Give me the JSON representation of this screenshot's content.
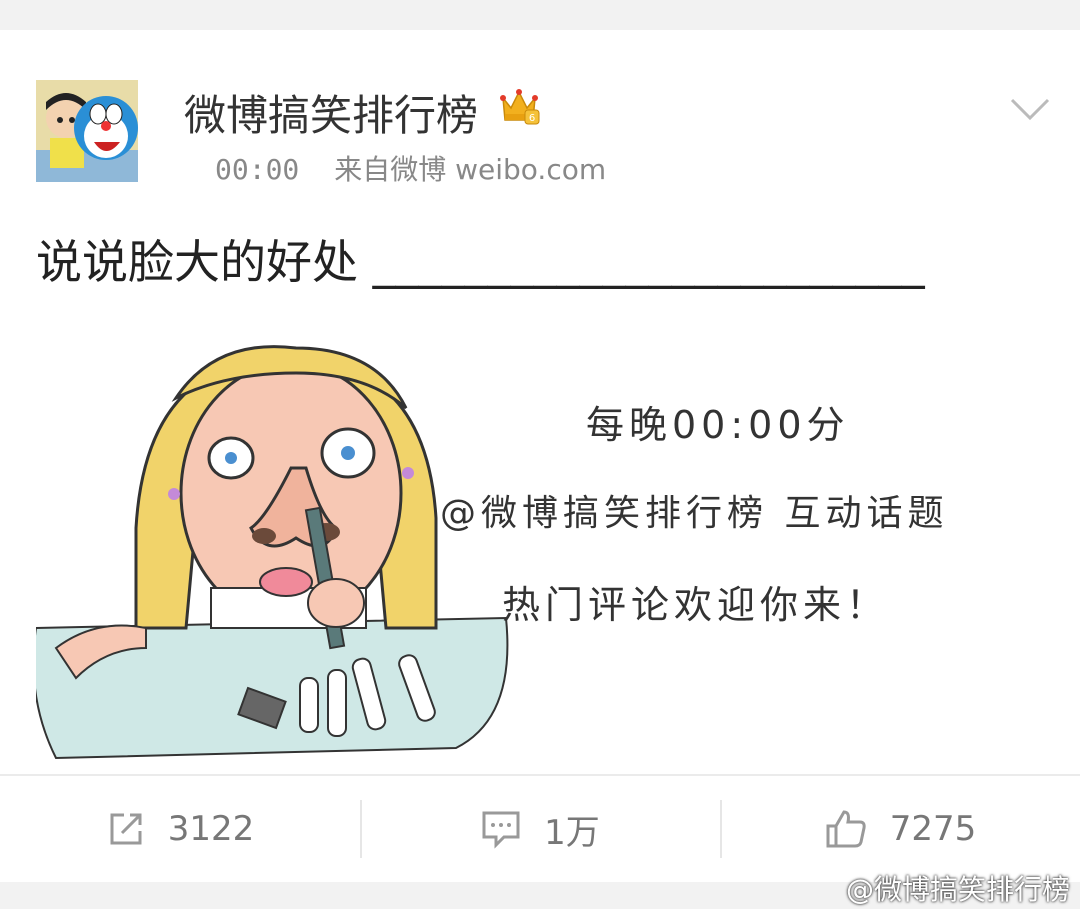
{
  "post": {
    "user_name": "微博搞笑排行榜",
    "time": "00:00",
    "source": "来自微博 weibo.com",
    "text": "说说脸大的好处 ________________________",
    "vip_icon": "crown-badge-icon",
    "menu_icon": "chevron-down-icon"
  },
  "image": {
    "line1": "每晚00:00分",
    "line2": "@微博搞笑排行榜  互动话题",
    "line3": "热门评论欢迎你来！"
  },
  "actions": {
    "repost_count": "3122",
    "comment_count": "1万",
    "like_count": "7275"
  },
  "watermark": "@微博搞笑排行榜",
  "colors": {
    "background": "#f2f2f2",
    "card": "#ffffff",
    "vip_gold": "#f2b01e",
    "icon_gray": "#999999"
  }
}
